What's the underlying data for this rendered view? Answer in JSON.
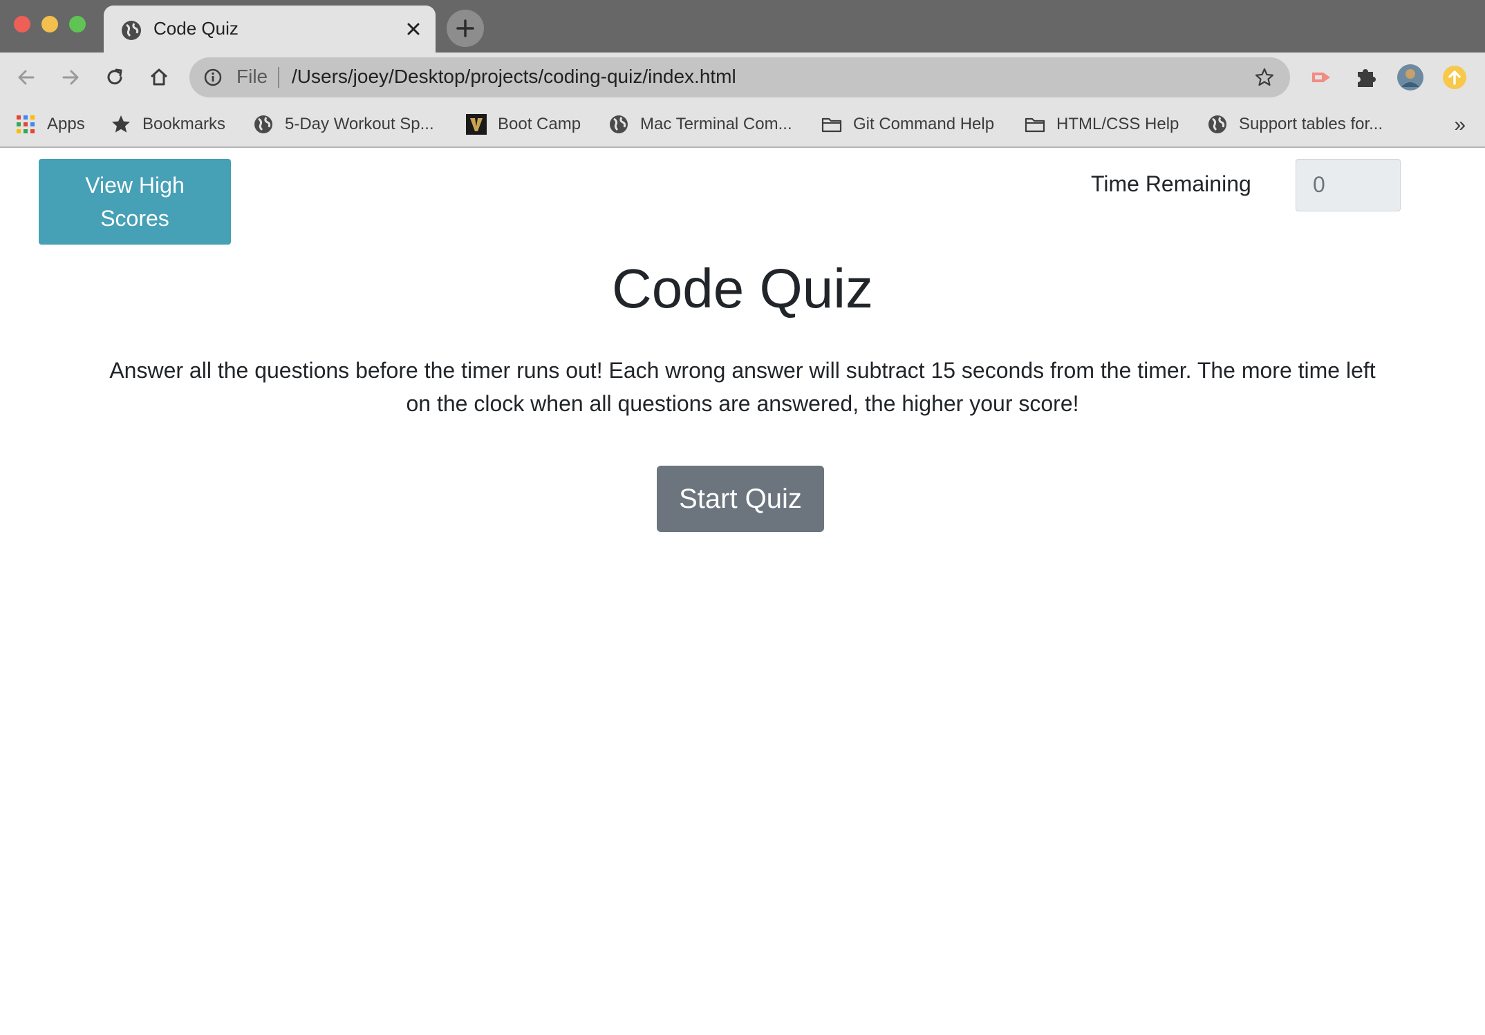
{
  "browser": {
    "tab_title": "Code Quiz",
    "omnibox": {
      "scheme_label": "File",
      "url": "/Users/joey/Desktop/projects/coding-quiz/index.html"
    },
    "bookmarks": [
      {
        "label": "Apps",
        "icon": "apps-grid-icon"
      },
      {
        "label": "Bookmarks",
        "icon": "star-icon"
      },
      {
        "label": "5-Day Workout Sp...",
        "icon": "globe-icon"
      },
      {
        "label": "Boot Camp",
        "icon": "vanderbilt-v-icon"
      },
      {
        "label": "Mac Terminal Com...",
        "icon": "globe-icon"
      },
      {
        "label": "Git Command Help",
        "icon": "folder-icon"
      },
      {
        "label": "HTML/CSS Help",
        "icon": "folder-icon"
      },
      {
        "label": "Support tables for...",
        "icon": "globe-icon"
      }
    ],
    "more_bookmarks": "»"
  },
  "page": {
    "high_scores_button": "View High Scores",
    "time_label": "Time Remaining",
    "time_value": "0",
    "title": "Code Quiz",
    "description": "Answer all the questions before the timer runs out! Each wrong answer will subtract 15 seconds from the timer. The more time left on the clock when all questions are answered, the higher your score!",
    "start_button": "Start Quiz"
  },
  "colors": {
    "info_button": "#46a0b6",
    "secondary_button": "#6c757d",
    "titlebar": "#676767",
    "toolbar": "#e3e3e3"
  }
}
